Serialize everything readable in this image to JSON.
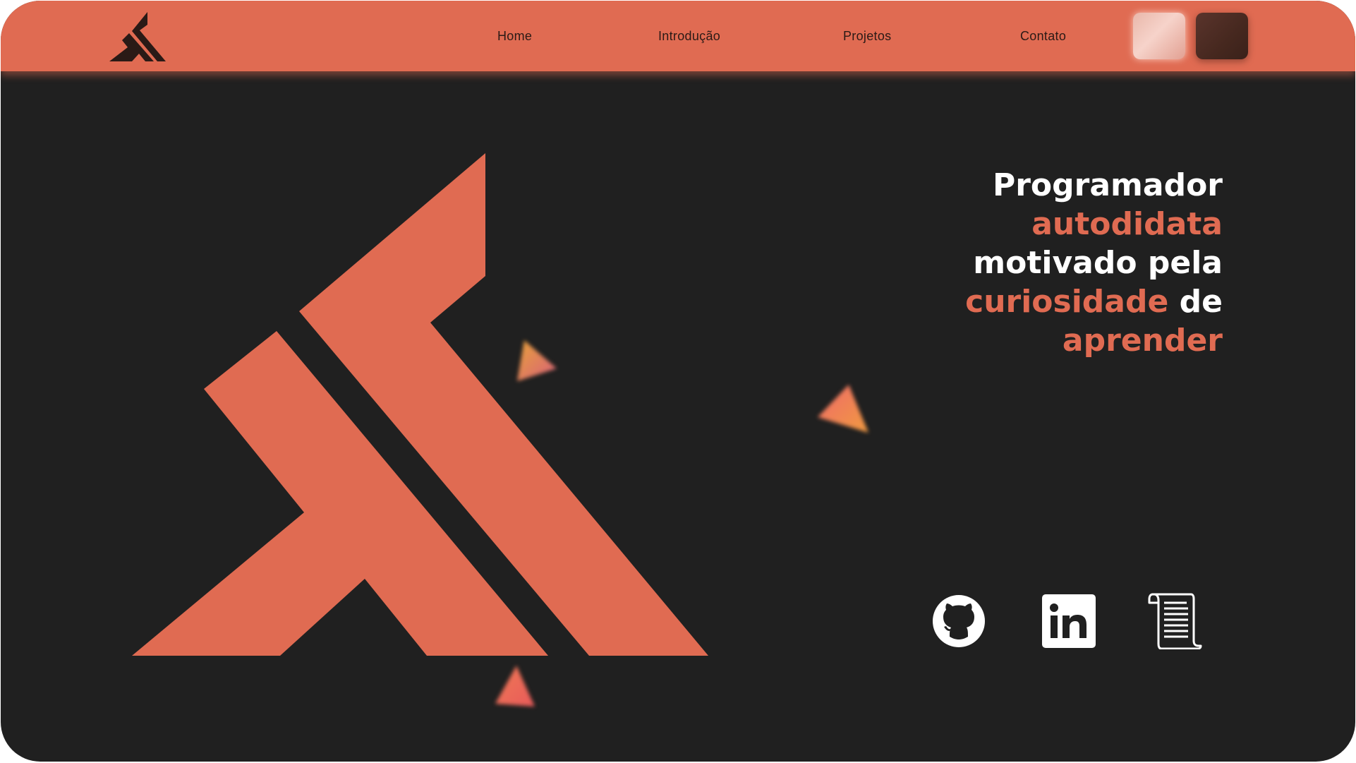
{
  "nav": {
    "links": [
      "Home",
      "Introdução",
      "Projetos",
      "Contato"
    ]
  },
  "theme_toggle": {
    "light_icon": "light-swatch",
    "dark_icon": "dark-swatch"
  },
  "hero": {
    "headline": {
      "w1": "Programador",
      "w2": "autodidata",
      "w3": "motivado pela",
      "w4": "curiosidade",
      "w5": "de",
      "w6": "aprender"
    }
  },
  "social": {
    "icons": [
      "github-icon",
      "linkedin-icon",
      "scroll-icon"
    ]
  },
  "colors": {
    "accent": "#e06b52",
    "background": "#202020",
    "text": "#ffffff",
    "nav_text": "#2a1a16"
  }
}
